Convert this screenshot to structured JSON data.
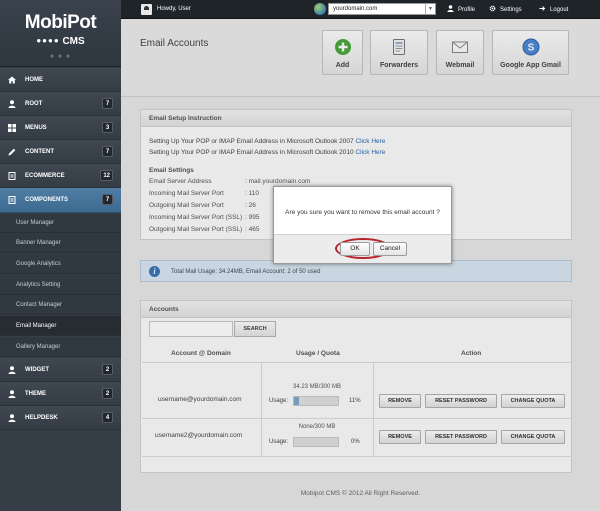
{
  "brand": {
    "name": "MobiPot",
    "sub": "CMS",
    "sub_dots": "●●●●",
    "handle": "● ● ●"
  },
  "sidebar": {
    "items": [
      {
        "name": "home",
        "label": "HOME",
        "count": ""
      },
      {
        "name": "root",
        "label": "ROOT",
        "count": "7"
      },
      {
        "name": "menus",
        "label": "MENUS",
        "count": "3"
      },
      {
        "name": "content",
        "label": "CONTENT",
        "count": "7"
      },
      {
        "name": "ecommerce",
        "label": "ECOMMERCE",
        "count": "12"
      },
      {
        "name": "components",
        "label": "COMPONENTS",
        "count": "7"
      }
    ],
    "sub_items": [
      {
        "label": "User Manager"
      },
      {
        "label": "Banner Manager"
      },
      {
        "label": "Google Analytics"
      },
      {
        "label": "Analytics Setting"
      },
      {
        "label": "Contact Manager"
      },
      {
        "label": "Email Manager"
      },
      {
        "label": "Gallery Manager"
      }
    ],
    "bottom_items": [
      {
        "name": "widget",
        "label": "WIDGET",
        "count": "2"
      },
      {
        "name": "theme",
        "label": "THEME",
        "count": "2"
      },
      {
        "name": "helpdesk",
        "label": "HELPDESK",
        "count": "4"
      }
    ]
  },
  "topbar": {
    "greeting": "Howdy, User",
    "domain": "yourdomain.com",
    "profile": "Profile",
    "settings": "Settings",
    "logout": "Logout"
  },
  "page": {
    "title": "Email Accounts"
  },
  "quick_actions": [
    {
      "label": "Add",
      "icon": "add-icon"
    },
    {
      "label": "Forwarders",
      "icon": "forwarders-icon"
    },
    {
      "label": "Webmail",
      "icon": "webmail-icon"
    },
    {
      "label": "Google App Gmail",
      "icon": "google-app-icon"
    }
  ],
  "setup": {
    "title": "Email Setup Instruction",
    "line1": "Setting Up Your POP or IMAP Email Address in Microsoft Outlook 2007",
    "line2": "Setting Up Your POP or IMAP Email Address in Microsoft Outlook 2010",
    "click_here": "Click Here",
    "settings_title": "Email Settings",
    "rows": [
      {
        "label": "Email Server Address",
        "value": ": mail.yourdomain.com"
      },
      {
        "label": "Incoming Mail Server Port",
        "value": ": 110"
      },
      {
        "label": "Outgoing Mail Server Port",
        "value": ": 26"
      },
      {
        "label": "Incoming Mail Server Port (SSL)",
        "value": ": 995"
      },
      {
        "label": "Outgoing Mail Server Port (SSL)",
        "value": ": 465"
      }
    ]
  },
  "info": {
    "text": "Total Mail Usage: 34.24MB, Email Account: 2 of 50 used"
  },
  "accounts": {
    "title": "Accounts",
    "search_button": "SEARCH",
    "headers": {
      "account": "Account @ Domain",
      "usage": "Usage / Quota",
      "action": "Action"
    },
    "usage_label": "Usage:",
    "rows": [
      {
        "email": "username@yourdomain.com",
        "quota": "34.23 MB/300 MB",
        "percent_text": "11%",
        "usage_fraction": 0.11
      },
      {
        "email": "username2@yourdomain.com",
        "quota": "None/300 MB",
        "percent_text": "0%",
        "usage_fraction": 0
      }
    ],
    "actions": {
      "remove": "REMOVE",
      "reset": "RESET PASSWORD",
      "change": "CHANGE QUOTA"
    }
  },
  "footer": {
    "text": "Mobipot CMS © 2012 All Right Reserved."
  },
  "modal": {
    "message": "Are you sure you want to remove this email account ?",
    "ok": "OK",
    "cancel": "Cancel"
  },
  "colors": {
    "sidebar": "#353d46",
    "active": "#4f7da3",
    "accent_red": "#b8242a",
    "link": "#2a6bb0",
    "bar_fill": "#7fa6cb"
  }
}
